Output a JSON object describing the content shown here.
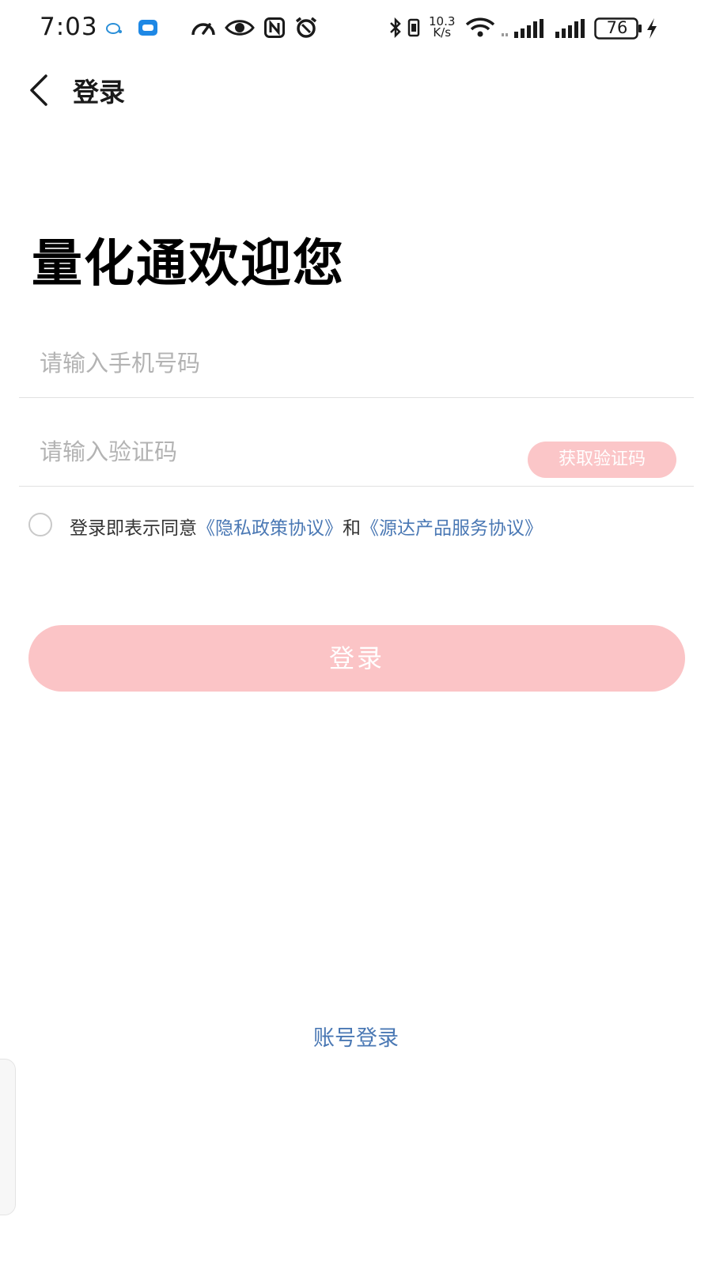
{
  "status_bar": {
    "time": "7:03",
    "net_speed_value": "10.3",
    "net_speed_unit": "K/s",
    "battery": "76",
    "icons": [
      "chat-notification-icon",
      "message-app-icon",
      "speedometer-icon",
      "eye-icon",
      "nfc-icon",
      "alarm-icon",
      "bluetooth-icon",
      "vibrate-icon",
      "wifi-icon",
      "signal-1-icon",
      "signal-2-icon",
      "battery-icon",
      "charging-icon"
    ]
  },
  "nav": {
    "back_icon": "chevron-left-icon",
    "title": "登录"
  },
  "welcome": "量化通欢迎您",
  "form": {
    "phone_placeholder": "请输入手机号码",
    "code_placeholder": "请输入验证码",
    "get_code_label": "获取验证码"
  },
  "agreement": {
    "prefix": "登录即表示同意",
    "privacy_link": "《隐私政策协议》",
    "and": "和",
    "service_link": "《源达产品服务协议》"
  },
  "login_button": "登录",
  "account_login": "账号登录",
  "colors": {
    "accent_pink": "#fbc4c6",
    "link_blue": "#4a78b4",
    "placeholder_gray": "#b3b3b3",
    "divider": "#e1e1e1"
  }
}
